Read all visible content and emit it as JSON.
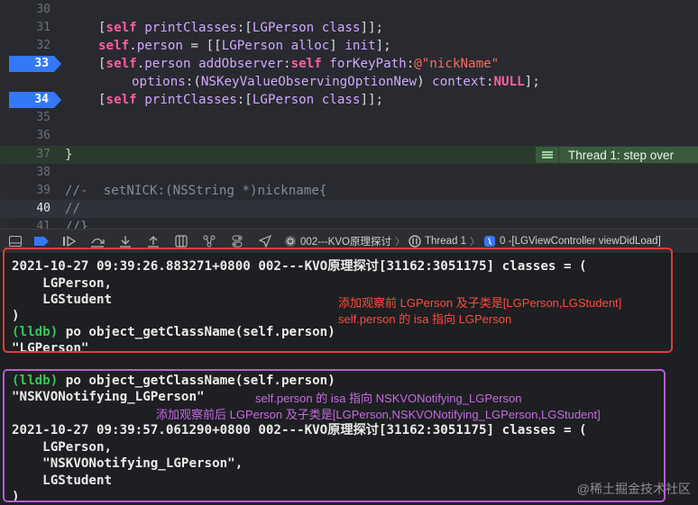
{
  "editor": {
    "lines": [
      {
        "num": "30",
        "code": ""
      },
      {
        "num": "31",
        "code": "[self printClasses:[LGPerson class]];"
      },
      {
        "num": "32",
        "code": "self.person = [[LGPerson alloc] init];"
      },
      {
        "num": "33",
        "code": "[self.person addObserver:self forKeyPath:@\"nickName\"",
        "breakpoint": true
      },
      {
        "num": "",
        "code": "options:(NSKeyValueObservingOptionNew) context:NULL];"
      },
      {
        "num": "34",
        "code": "[self printClasses:[LGPerson class]];",
        "breakpoint": true
      },
      {
        "num": "35",
        "code": ""
      },
      {
        "num": "36",
        "code": ""
      },
      {
        "num": "37",
        "code": "}"
      },
      {
        "num": "38",
        "code": ""
      },
      {
        "num": "39",
        "code": "//-  setNICK:(NSString *)nickname{"
      },
      {
        "num": "40",
        "code": "//"
      },
      {
        "num": "41",
        "code": "//}"
      }
    ],
    "thread_badge": "Thread 1: step over"
  },
  "toolbar": {
    "crumb_project": "002---KVO原理探讨",
    "crumb_thread": "Thread 1",
    "crumb_frame": "0 -[LGViewController viewDidLoad]",
    "icons": [
      "hide-console-icon",
      "breakpoints-toggle-icon",
      "continue-icon",
      "step-over-icon",
      "step-into-icon",
      "step-out-icon",
      "view-hierarchy-icon",
      "memory-graph-icon",
      "environment-overrides-icon",
      "location-icon"
    ]
  },
  "console": {
    "block1": {
      "line1": "2021-10-27 09:39:26.883271+0800 002---KVO原理探讨[31162:3051175] classes = (",
      "line2": "    LGPerson,",
      "line3": "    LGStudent",
      "line4": ")",
      "prompt": "(lldb)",
      "cmd": " po object_getClassName(self.person)",
      "result": "\"LGPerson\""
    },
    "block2": {
      "prompt": "(lldb)",
      "cmd": " po object_getClassName(self.person)",
      "result": "\"NSKVONotifying_LGPerson\"",
      "line1": "2021-10-27 09:39:57.061290+0800 002---KVO原理探讨[31162:3051175] classes = (",
      "line2": "    LGPerson,",
      "line3": "    \"NSKVONotifying_LGPerson\",",
      "line4": "    LGStudent",
      "line5": ")"
    },
    "notes": {
      "red1": "添加观察前 LGPerson 及子类是[LGPerson,LGStudent]",
      "red2": "self.person 的 isa 指向 LGPerson",
      "purple1": "self.person 的 isa 指向 NSKVONotifying_LGPerson",
      "purple2": "添加观察前后 LGPerson 及子类是[LGPerson,NSKVONotifying_LGPerson,LGStudent]"
    },
    "watermark": "@稀土掘金技术社区"
  },
  "colors": {
    "accent_breakpoint": "#3478f6",
    "annotation_red": "#e23b3b",
    "annotation_purple": "#b85bd6",
    "lldb_prompt": "#34c759"
  }
}
